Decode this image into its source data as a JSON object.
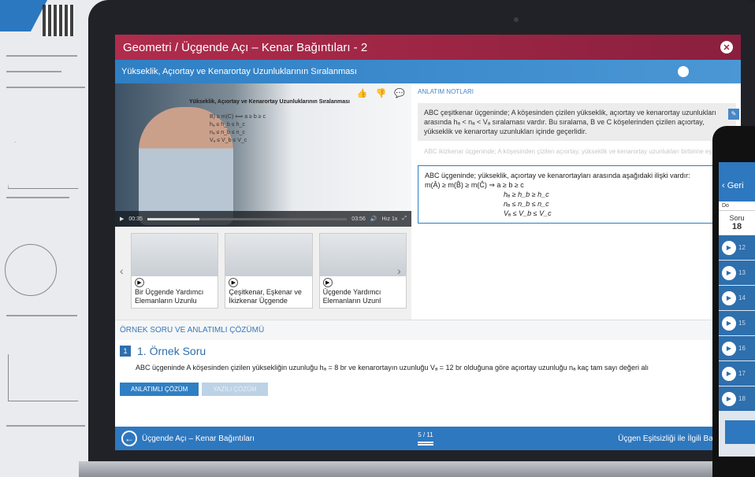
{
  "window": {
    "title": "Geometri / Üçgende Açı – Kenar Bağıntıları - 2",
    "subtitle": "Yükseklik, Açıortay ve Kenarortay Uzunluklarının Sıralanması"
  },
  "video": {
    "board_title": "Yükseklik, Açıortay ve Kenarortay Uzunluklarının Sıralanması",
    "board_math": "B) ≥ m(C) ⟺ a ≥ b ≥ c\nhₐ ≤ h_b ≤ h_c\nnₐ ≤ n_b ≤ n_c\nVₐ ≤ V_b ≤ V_c",
    "current_time": "00:35",
    "total_time": "03:56",
    "progress": 0.26,
    "speed_label": "Hız 1x"
  },
  "thumbnails": [
    {
      "title": "Bir Üçgende Yardımcı Elemanların Uzunlu"
    },
    {
      "title": "Çeşitkenar, Eşkenar ve İkizkenar Üçgende"
    },
    {
      "title": "Üçgende Yardımcı Elemanların Uzunl"
    }
  ],
  "notes": {
    "header": "ANLATIM NOTLARI",
    "note1": "ABC çeşitkenar üçgeninde; A köşesinden çizilen yükseklik, açıortay ve kenarortay uzunlukları arasında hₐ < nₐ < Vₐ sıralaması vardır. Bu sıralama, B ve C köşelerinden çizilen açıortay, yükseklik ve kenarortay uzunlukları içinde geçerlidir.",
    "note2": "ABC ikizkenar üçgeninde; A köşesinden çizilen açıortay, yükseklik ve kenarortay uzunlukları birbirine eşittir.",
    "note3_intro": "ABC üçgeninde; yükseklik, açıortay ve kenarortayları arasında aşağıdaki ilişki vardır:",
    "note3_main": "m(Â) ≥ m(B̂) ≥ m(Ĉ) ⇒ a ≥ b ≥ c",
    "formula1": "hₐ ≥ h_b ≥ h_c",
    "formula2": "nₐ ≤ n_b ≤ n_c",
    "formula3": "Vₐ ≤ V_b ≤ V_c"
  },
  "example": {
    "section_header": "ÖRNEK SORU VE ANLATIMLI ÇÖZÜMÜ",
    "number": "1",
    "title": "1. Örnek Soru",
    "question": "ABC üçgeninde A köşesinden çizilen yüksekliğin uzunluğu hₐ = 8 br ve kenarortayın uzunluğu Vₐ = 12 br olduğuna göre açıortay uzunluğu nₐ kaç tam sayı değeri alı",
    "tab_explained": "ANLATIMLI ÇÖZÜM",
    "tab_written": "YAZILI ÇÖZÜM"
  },
  "footer": {
    "prev_label": "Üçgende Açı – Kenar Bağıntıları",
    "page": "5 / 11",
    "next_label": "Üçgen Eşitsizliği ile İlgili Bağıntıla"
  },
  "phone": {
    "back_label": "Geri",
    "tab_label": "Do",
    "soru_label": "Soru",
    "soru_count": "18",
    "rows": [
      "12",
      "13",
      "14",
      "15",
      "16",
      "17",
      "18"
    ]
  },
  "colors": {
    "title_bar": "#a52647",
    "accent_blue": "#2f7fc4"
  }
}
